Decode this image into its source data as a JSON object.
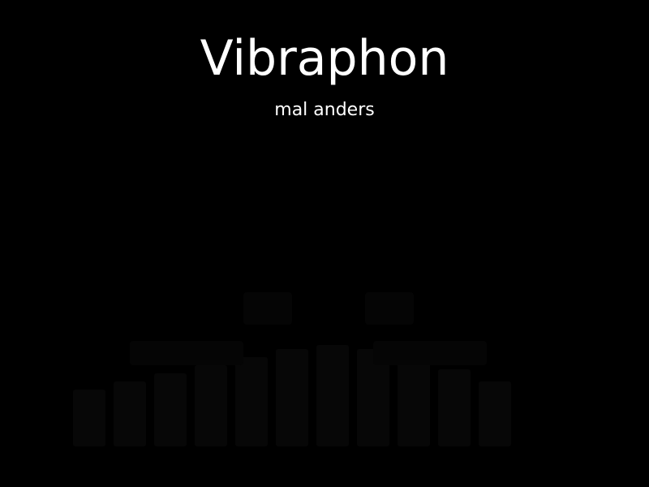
{
  "slide": {
    "title": "Vibraphon",
    "subtitle": "mal anders",
    "background_color": "#000000",
    "text_color": "#ffffff",
    "background_image": "vibraphone-silhouette-icon"
  }
}
